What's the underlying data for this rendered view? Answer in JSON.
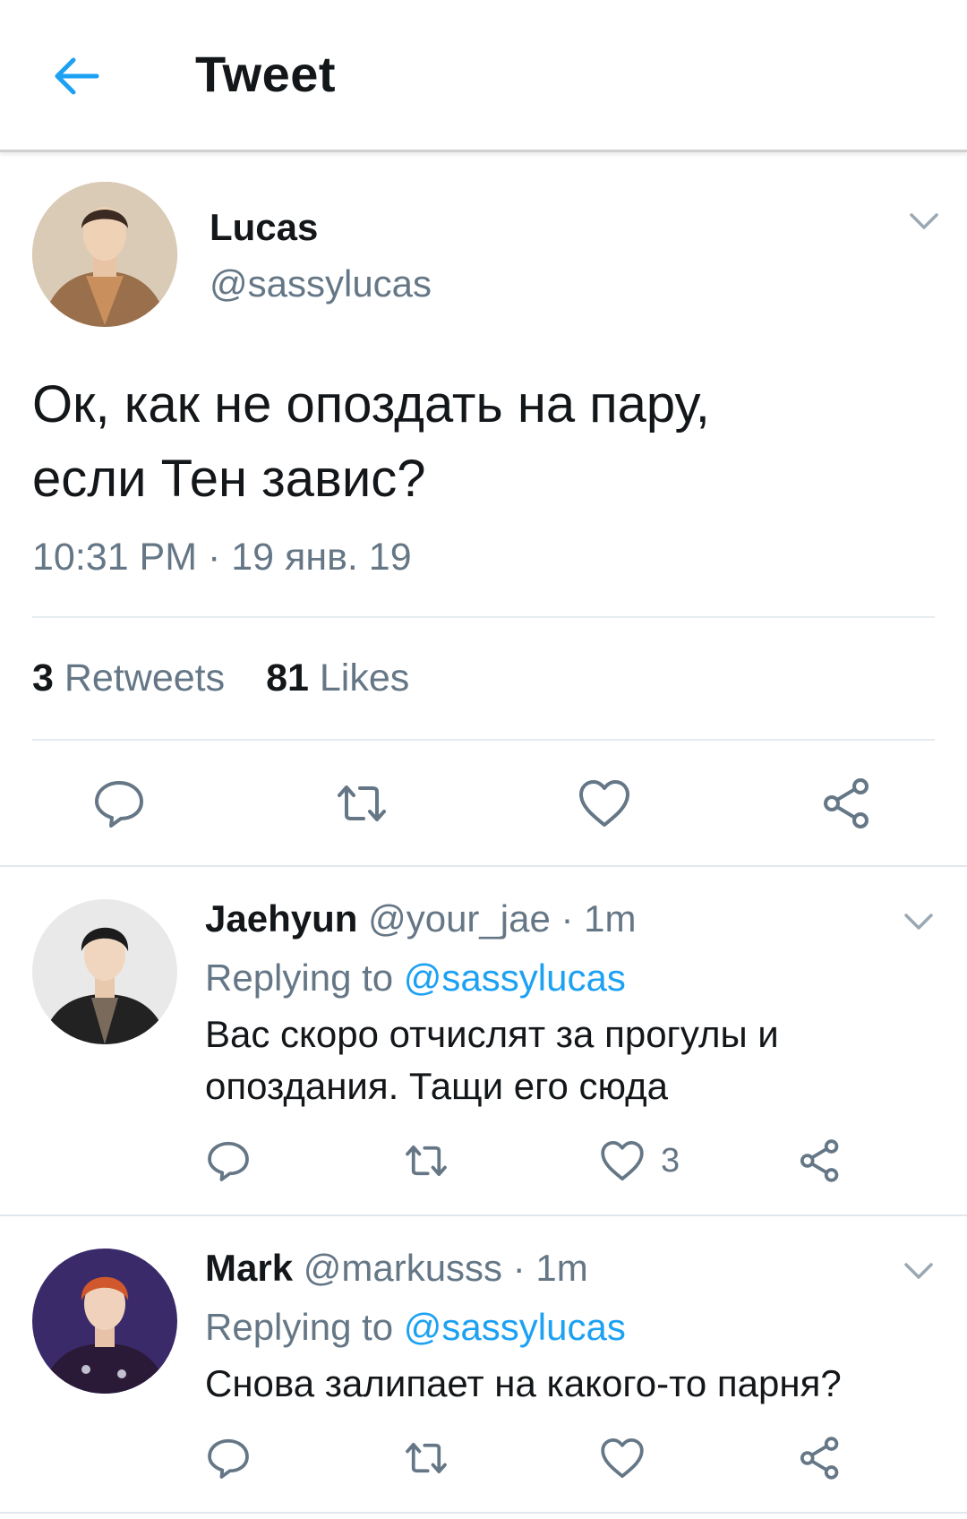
{
  "header": {
    "title": "Tweet",
    "back_icon": "arrow-left-icon"
  },
  "colors": {
    "accent": "#1da1f2",
    "text": "#14171a",
    "secondary": "#657786",
    "divider": "#e6ecf0"
  },
  "tweet": {
    "name": "Lucas",
    "handle": "@sassylucas",
    "text_line1": "Ок, как не опоздать на пару,",
    "text_line2": "если Тен завис?",
    "timestamp": "10:31 PM · 19 янв. 19",
    "retweets_count": "3",
    "retweets_label": "Retweets",
    "likes_count": "81",
    "likes_label": "Likes"
  },
  "replies": [
    {
      "name": "Jaehyun",
      "handle": "@your_jae",
      "time": "· 1m",
      "replying_prefix": "Replying to",
      "replying_to": "@sassylucas",
      "text_line1": "Вас скоро отчислят за прогулы и",
      "text_line2": "опоздания. Тащи его сюда",
      "like_count": "3"
    },
    {
      "name": "Mark",
      "handle": "@markusss",
      "time": "· 1m",
      "replying_prefix": "Replying to",
      "replying_to": "@sassylucas",
      "text_line1": "Снова залипает на какого-то парня?",
      "like_count": ""
    }
  ]
}
